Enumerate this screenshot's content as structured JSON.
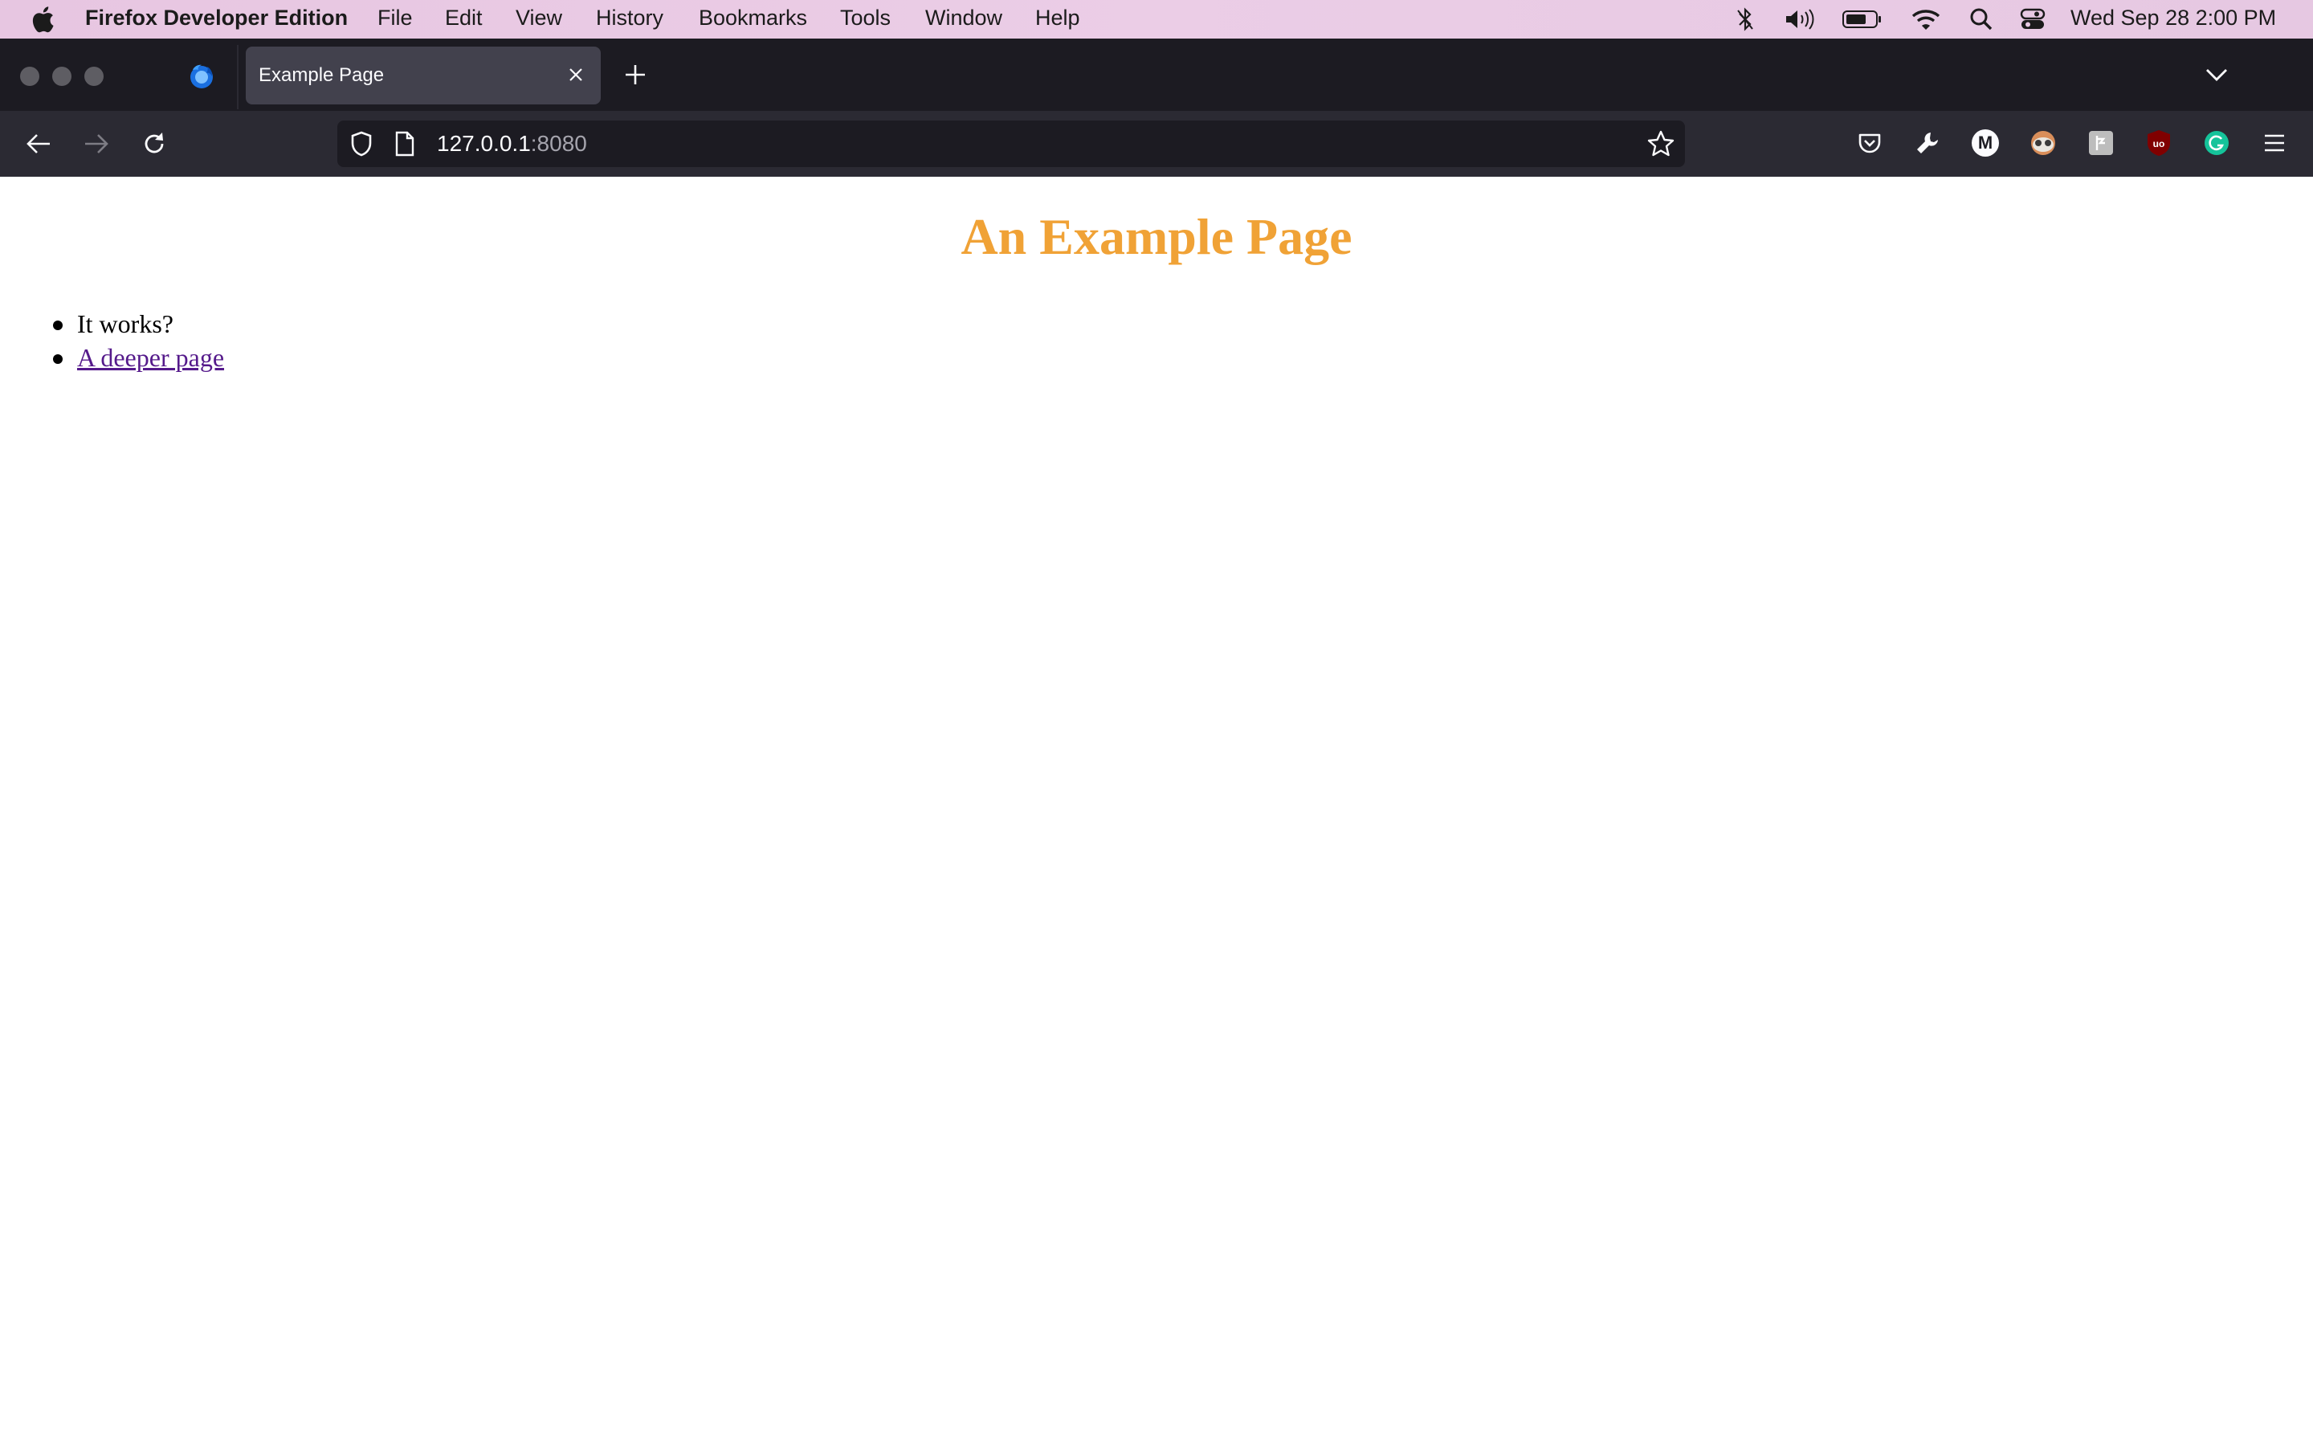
{
  "menubar": {
    "app_name": "Firefox Developer Edition",
    "items": [
      "File",
      "Edit",
      "View",
      "History",
      "Bookmarks",
      "Tools",
      "Window",
      "Help"
    ],
    "clock": "Wed Sep 28  2:00 PM"
  },
  "tab": {
    "title": "Example Page"
  },
  "urlbar": {
    "host": "127.0.0.1",
    "port": ":8080"
  },
  "extensions": {
    "m_label": "M",
    "ublock_label": "uo"
  },
  "page": {
    "heading": "An Example Page",
    "items": [
      {
        "text": "It works?"
      },
      {
        "text": "A deeper page",
        "is_link": true
      }
    ]
  },
  "colors": {
    "heading": "#f0a236",
    "link_visited": "#551a8b",
    "browser_chrome": "#1c1b22"
  }
}
